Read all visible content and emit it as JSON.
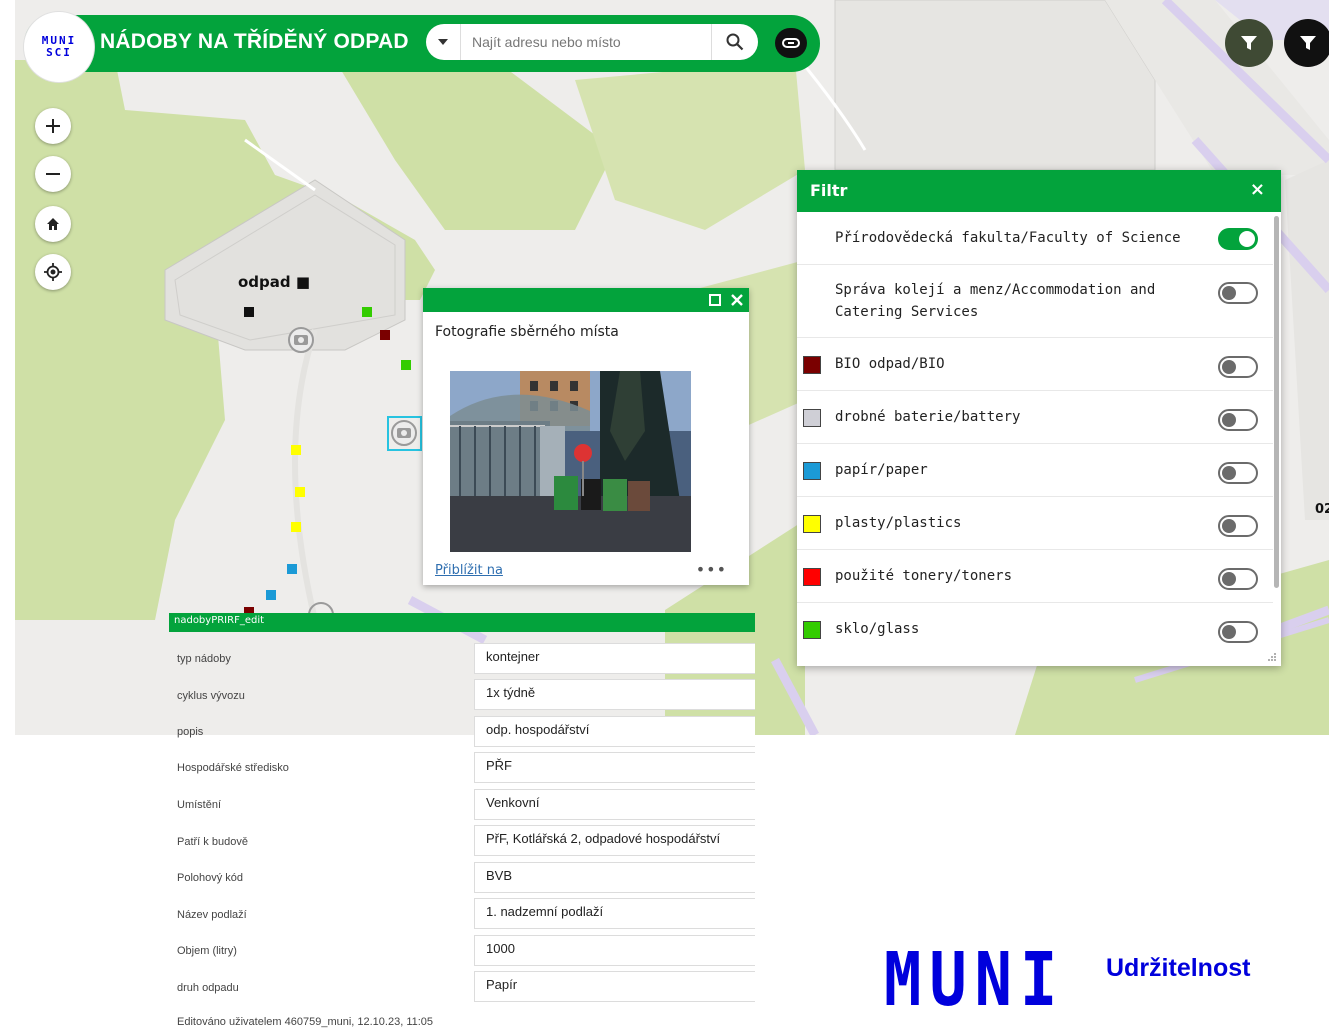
{
  "header": {
    "logo_line1": "MUNI",
    "logo_line2": "SCI",
    "title": "NÁDOBY NA TŘÍDĚNÝ ODPAD",
    "search_placeholder": "Najít adresu nebo místo"
  },
  "map": {
    "label": "odpad ■",
    "edge_text": "02"
  },
  "popup": {
    "title": "Fotografie sběrného místa",
    "zoom_link": "Přiblížit na",
    "more": "•••"
  },
  "filter": {
    "title": "Filtr",
    "close": "×",
    "items": [
      {
        "label": "Přírodovědecká fakulta/Faculty of Science",
        "on": true,
        "color": null
      },
      {
        "label": "Správa kolejí a menz/Accommodation and Catering Services",
        "on": false,
        "color": null
      },
      {
        "label": "BIO odpad/BIO",
        "on": false,
        "color": "#7a0000"
      },
      {
        "label": "drobné baterie/battery",
        "on": false,
        "color": "#cfcfd6"
      },
      {
        "label": "papír/paper",
        "on": false,
        "color": "#1b9ad6"
      },
      {
        "label": "plasty/plastics",
        "on": false,
        "color": "#ffff00"
      },
      {
        "label": "použité tonery/toners",
        "on": false,
        "color": "#ff0000"
      },
      {
        "label": "sklo/glass",
        "on": false,
        "color": "#33cc00"
      }
    ]
  },
  "attributes": {
    "layer": "nadobyPRIRF_edit",
    "rows": [
      {
        "label": "typ nádoby",
        "value": "kontejner"
      },
      {
        "label": "cyklus vývozu",
        "value": "1x týdně"
      },
      {
        "label": "popis",
        "value": "odp. hospodářství"
      },
      {
        "label": "Hospodářské středisko",
        "value": "PŘF"
      },
      {
        "label": "Umístění",
        "value": "Venkovní"
      },
      {
        "label": "Patří k budově",
        "value": "PřF, Kotlářská 2, odpadové hospodářství"
      },
      {
        "label": "Polohový kód",
        "value": "BVB"
      },
      {
        "label": "Název podlaží",
        "value": "1. nadzemní podlaží"
      },
      {
        "label": "Objem (litry)",
        "value": "1000"
      },
      {
        "label": "druh odpadu",
        "value": "Papír"
      }
    ],
    "edited": "Editováno uživatelem 460759_muni, 12.10.23, 11:05"
  },
  "branding": {
    "logo": "MUNI",
    "text": "Udržitelnost"
  }
}
